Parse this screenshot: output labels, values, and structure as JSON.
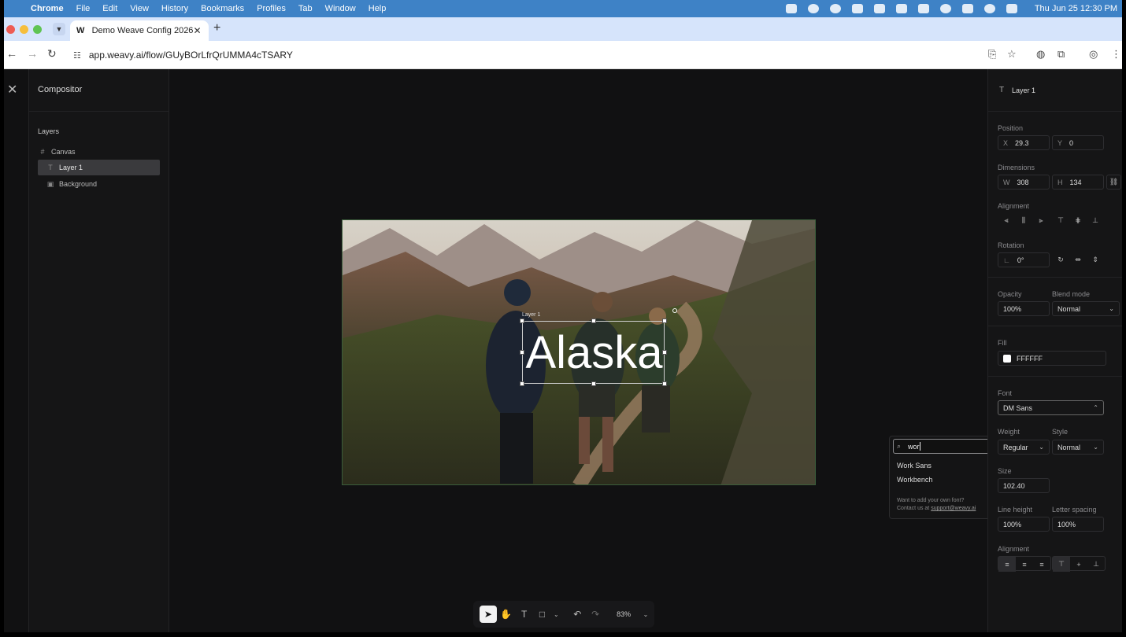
{
  "menubar": {
    "app": "Chrome",
    "items": [
      "File",
      "Edit",
      "View",
      "History",
      "Bookmarks",
      "Profiles",
      "Tab",
      "Window",
      "Help"
    ],
    "clock": "Thu Jun 25  12:30 PM"
  },
  "browser": {
    "tab_title": "Demo Weave Config 2026",
    "favicon": "W",
    "url": "app.weavy.ai/flow/GUyBOrLfrQrUMMA4cTSARY"
  },
  "left_panel": {
    "title": "Compositor",
    "layers_heading": "Layers",
    "layers": [
      {
        "label": "Canvas",
        "icon": "grid-icon"
      },
      {
        "label": "Layer 1",
        "icon": "text-icon"
      },
      {
        "label": "Background",
        "icon": "image-icon"
      }
    ]
  },
  "canvas": {
    "text": "Alaska",
    "layer_tag": "Layer 1"
  },
  "bottom_bar": {
    "zoom": "83%"
  },
  "font_popup": {
    "query": "wor",
    "options": [
      "Work Sans",
      "Workbench"
    ],
    "help_line1": "Want to add your own font?",
    "help_line2_prefix": "Contact us at ",
    "help_email": "support@weavy.ai"
  },
  "right_panel": {
    "layer_name": "Layer 1",
    "position": {
      "label": "Position",
      "x_label": "X",
      "x": "29.3",
      "y_label": "Y",
      "y": "0"
    },
    "dimensions": {
      "label": "Dimensions",
      "w_label": "W",
      "w": "308",
      "h_label": "H",
      "h": "134"
    },
    "alignment_label": "Alignment",
    "rotation": {
      "label": "Rotation",
      "value": "0°"
    },
    "opacity": {
      "label": "Opacity",
      "value": "100%"
    },
    "blend": {
      "label": "Blend mode",
      "value": "Normal"
    },
    "fill": {
      "label": "Fill",
      "value": "FFFFFF"
    },
    "font": {
      "label": "Font",
      "value": "DM Sans"
    },
    "weight": {
      "label": "Weight",
      "value": "Regular"
    },
    "style": {
      "label": "Style",
      "value": "Normal"
    },
    "size": {
      "label": "Size",
      "value": "102.40"
    },
    "line_height": {
      "label": "Line height",
      "value": "100%"
    },
    "letter_spacing": {
      "label": "Letter spacing",
      "value": "100%"
    },
    "text_alignment_label": "Alignment"
  },
  "colors": {
    "menubar": "#3e82c6",
    "app_bg": "#111112",
    "panel_bg": "#151516"
  }
}
